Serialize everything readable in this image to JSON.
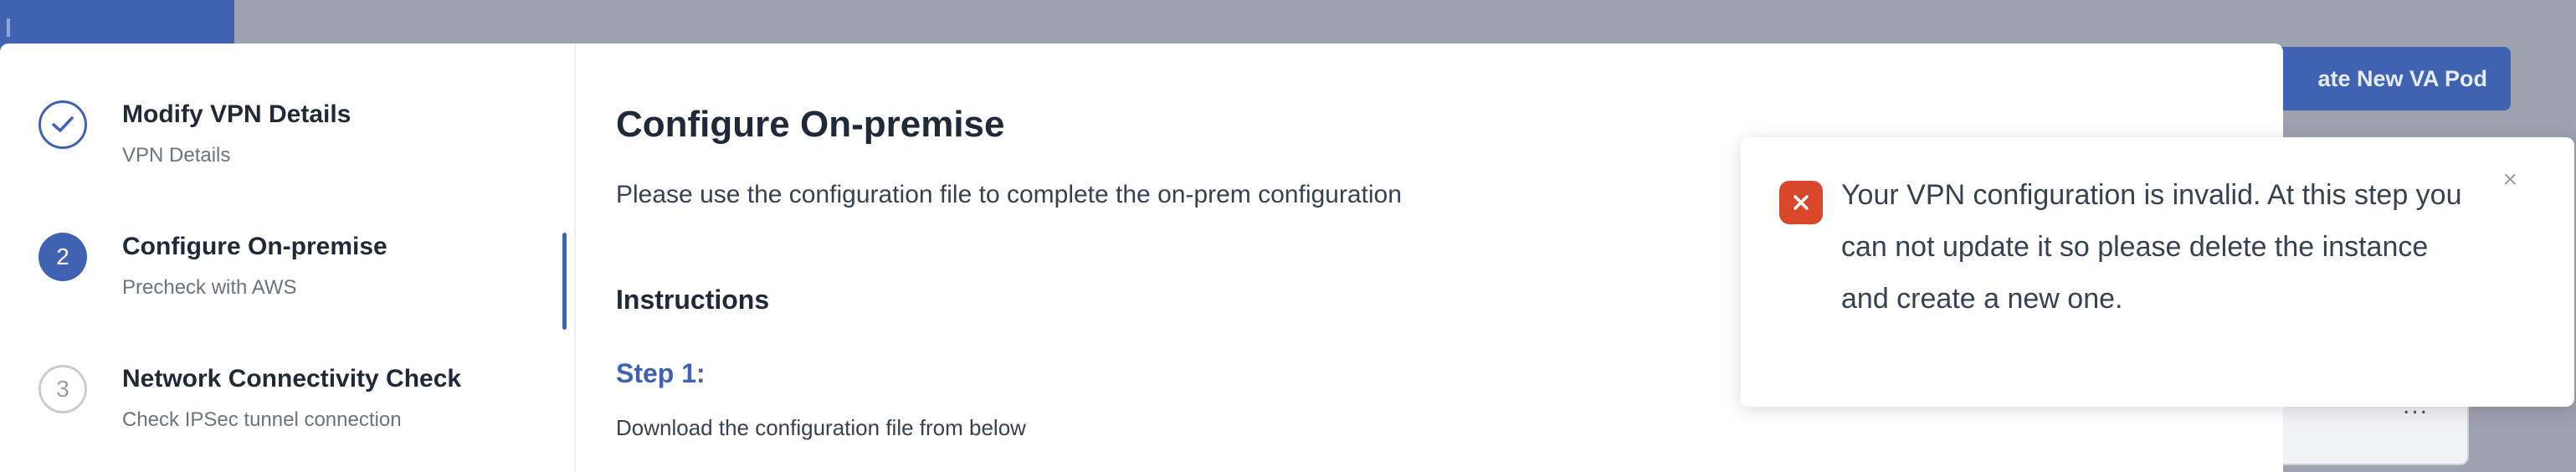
{
  "background": {
    "create_button_label": "ate New VA Pod"
  },
  "steps": [
    {
      "number": "",
      "title": "Modify VPN Details",
      "subtitle": "VPN Details",
      "state": "done"
    },
    {
      "number": "2",
      "title": "Configure On-premise",
      "subtitle": "Precheck with AWS",
      "state": "active"
    },
    {
      "number": "3",
      "title": "Network Connectivity Check",
      "subtitle": "Check IPSec tunnel connection",
      "state": "pending"
    }
  ],
  "content": {
    "title": "Configure On-premise",
    "description": "Please use the configuration file to complete the on-prem configuration",
    "instructions_heading": "Instructions",
    "step_heading": "Step 1:",
    "step_detail": "Download the configuration file from below"
  },
  "toast": {
    "message": "Your VPN configuration is invalid. At this step you can not update it so please delete the instance and create a new one.",
    "icon": "error-x-icon",
    "close_icon": "close-icon"
  },
  "colors": {
    "brand": "#3f63b0",
    "error": "#d9472b",
    "overlay": "#9ea1ae"
  }
}
